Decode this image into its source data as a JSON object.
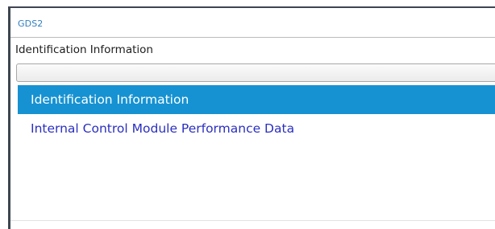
{
  "app": {
    "title": "GDS2"
  },
  "section": {
    "label": "Identification Information"
  },
  "dropdown": {
    "value": ""
  },
  "list": {
    "items": [
      {
        "label": "Identification Information",
        "selected": true
      },
      {
        "label": "Internal Control Module Performance Data",
        "selected": false
      }
    ]
  },
  "colors": {
    "accent": "#1692d2",
    "title": "#2f7fbf",
    "link": "#2a2fbf"
  }
}
